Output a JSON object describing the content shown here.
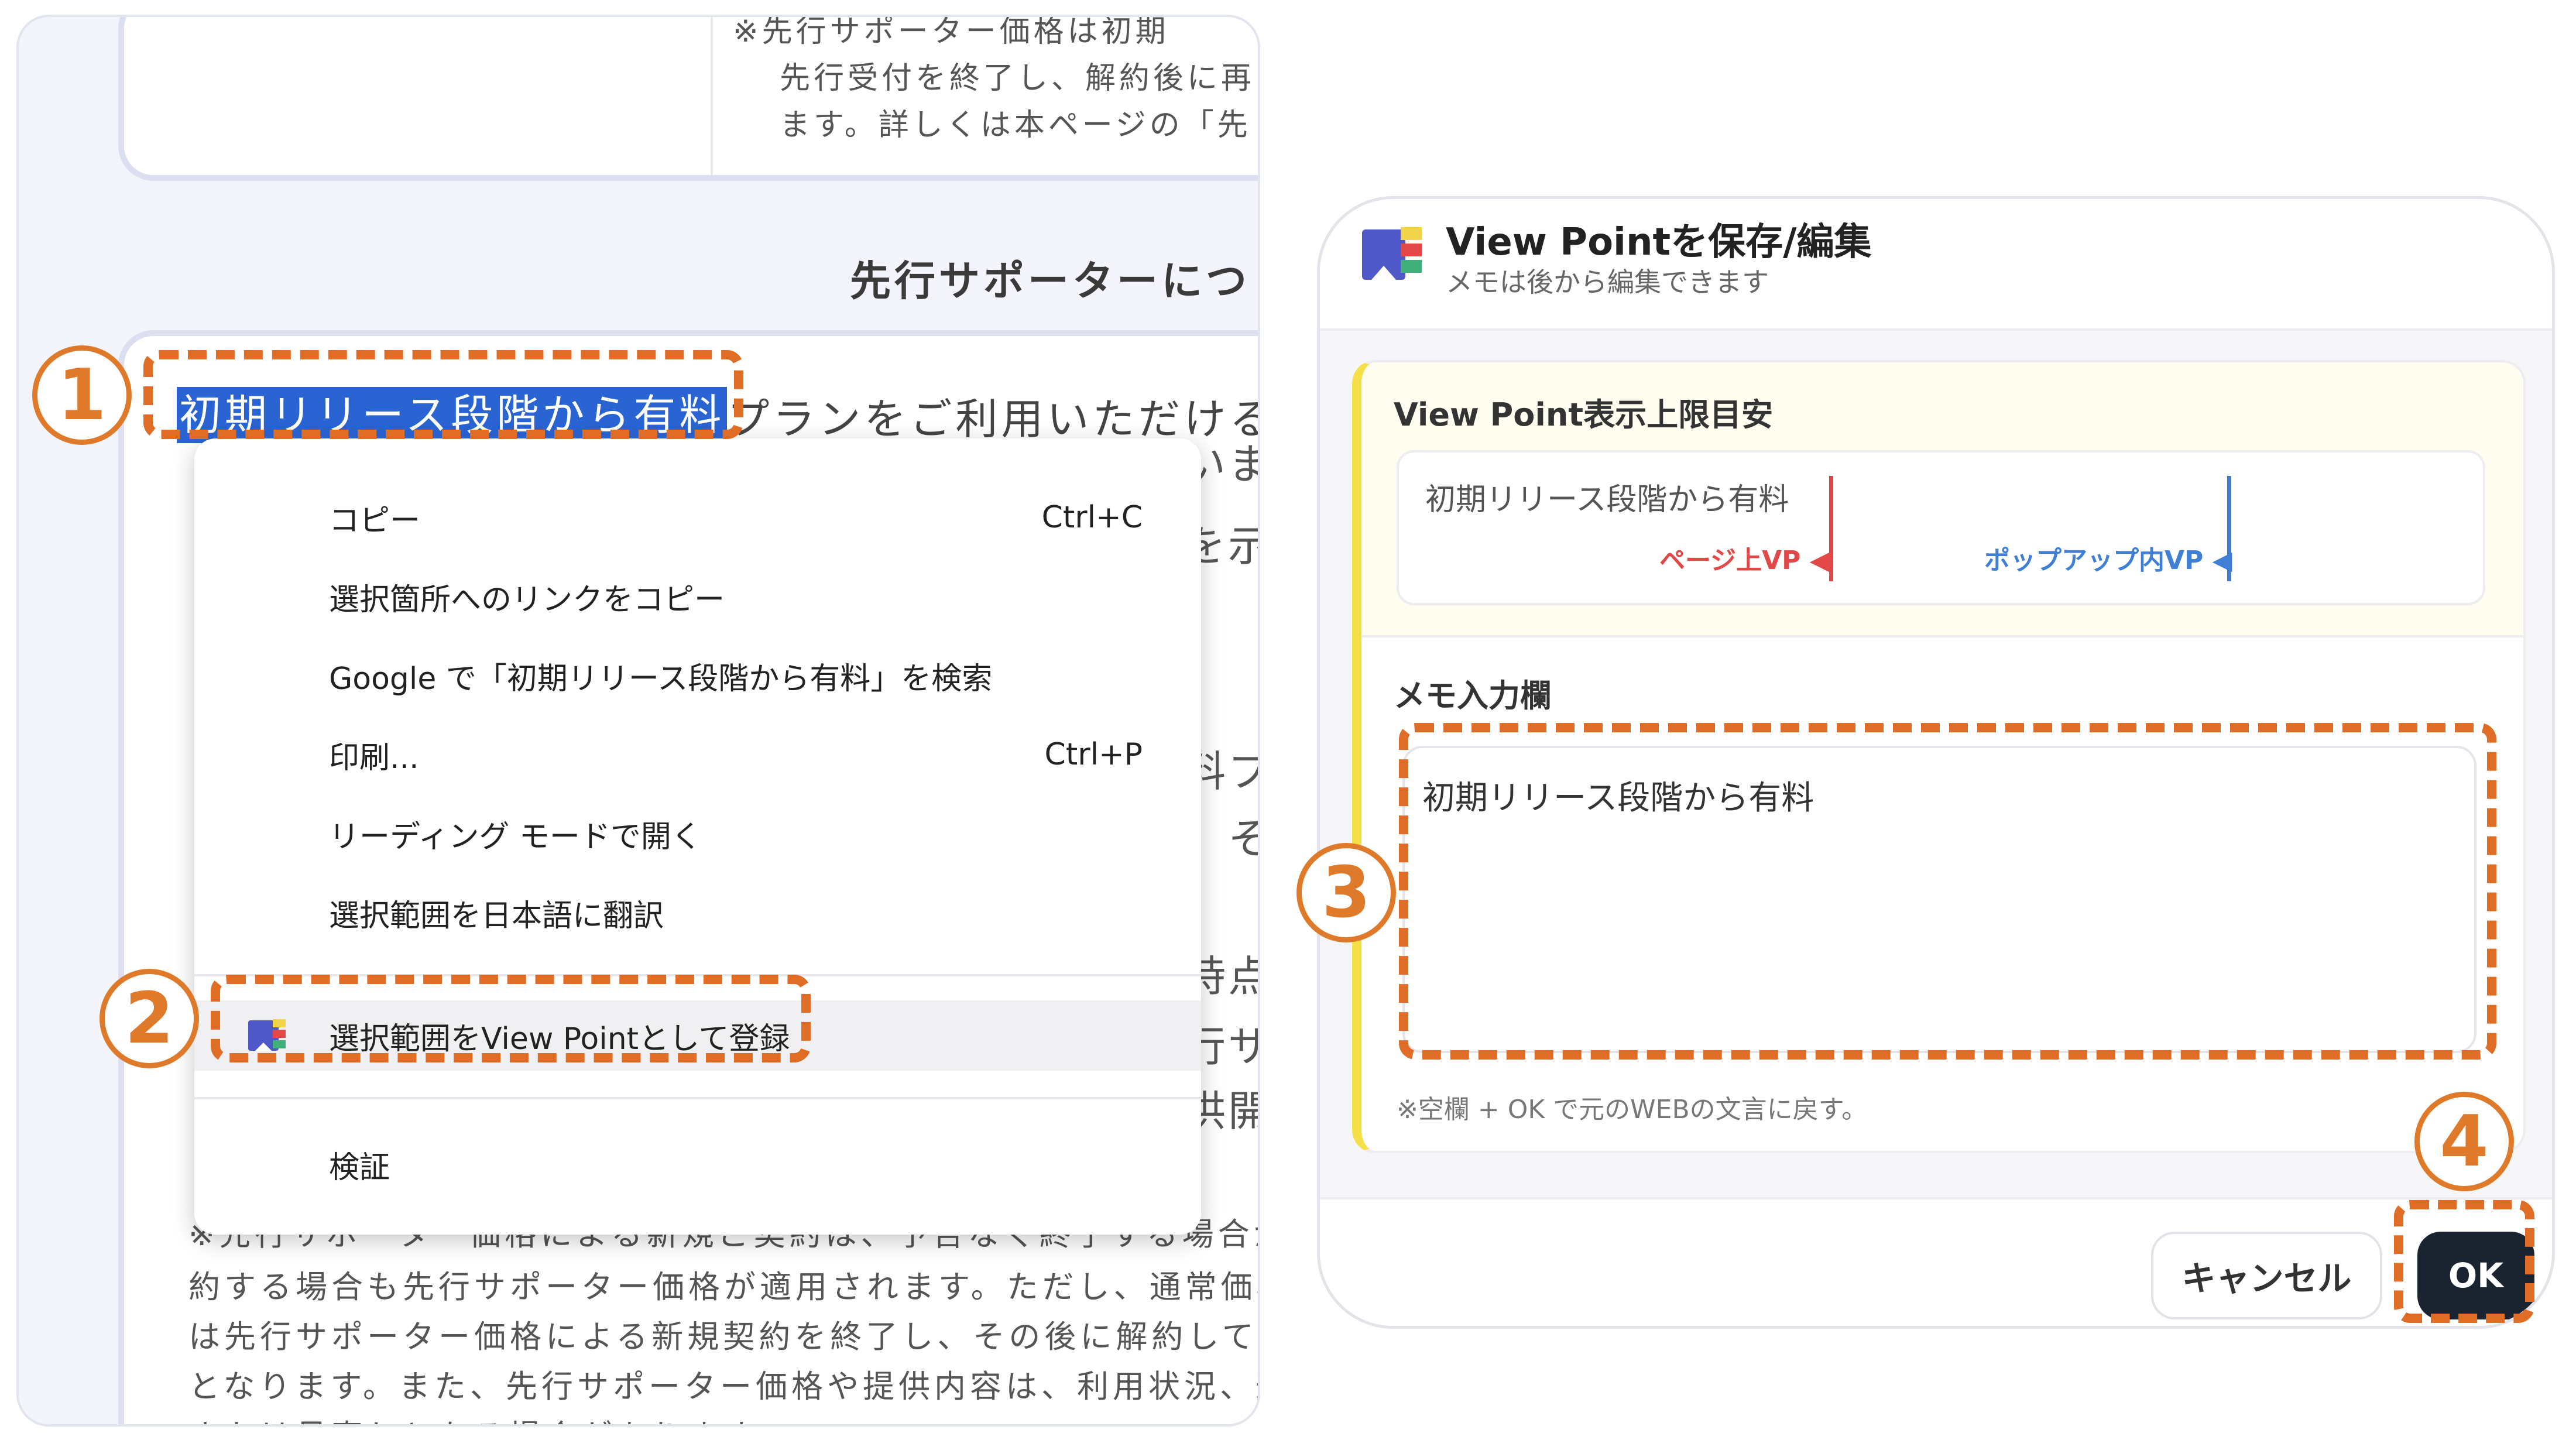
{
  "colors": {
    "accent_orange": "#e06d25",
    "selection_blue": "#2a64d3",
    "ok_button": "#1a2430",
    "vp_left_marker": "#e24848",
    "vp_right_marker": "#3f7fd6",
    "card_accent_yellow": "#f5e04a"
  },
  "webpage": {
    "top_text_lines": [
      "※先行サポーター価格は初期",
      "先行受付を終了し、解約後に再",
      "ます。詳しくは本ページの「先"
    ],
    "section_heading": "先行サポーターにつ",
    "selected_text": "初期リリース段階から有料",
    "after_selected_text": "プランをご利用いただける",
    "side_fragments": [
      "いま",
      "を示",
      "。",
      "料プ",
      "」そ",
      "時点で",
      "行サ",
      "供開"
    ],
    "body_lines": [
      "※先行サポーター価格による新規ご契約は、予告なく終了する場合があ",
      "約する場合も先行サポーター価格が適用されます。ただし、通常価格の販",
      "は先行サポーター価格による新規契約を終了し、その後に解約して再度",
      "となります。また、先行サポーター価格や提供内容は、利用状況、運営",
      "または見直しとなる場合があります。"
    ]
  },
  "context_menu": {
    "items": [
      {
        "label": "コピー",
        "shortcut": "Ctrl+C",
        "icon": ""
      },
      {
        "label": "選択箇所へのリンクをコピー",
        "shortcut": "",
        "icon": ""
      },
      {
        "label": "Google で「初期リリース段階から有料」を検索",
        "shortcut": "",
        "icon": ""
      },
      {
        "label": "印刷...",
        "shortcut": "Ctrl+P",
        "icon": ""
      },
      {
        "label": "リーディング モードで開く",
        "shortcut": "",
        "icon": ""
      },
      {
        "label": "選択範囲を日本語に翻訳",
        "shortcut": "",
        "icon": ""
      },
      {
        "label": "選択範囲をView Pointとして登録",
        "shortcut": "",
        "icon": "view-point-icon"
      },
      {
        "label": "検証",
        "shortcut": "",
        "icon": ""
      }
    ]
  },
  "steps": [
    "1",
    "2",
    "3",
    "4"
  ],
  "dialog": {
    "title": "View Pointを保存/編集",
    "subtitle": "メモは後から編集できます",
    "preview": {
      "label": "View Point表示上限目安",
      "text": "初期リリース段階から有料",
      "page_vp_label": "ページ上VP",
      "popup_vp_label": "ポップアップ内VP"
    },
    "memo": {
      "label": "メモ入力欄",
      "value": "初期リリース段階から有料",
      "hint": "※空欄 + OK で元のWEBの文言に戻す。"
    },
    "buttons": {
      "cancel": "キャンセル",
      "ok": "OK"
    }
  }
}
